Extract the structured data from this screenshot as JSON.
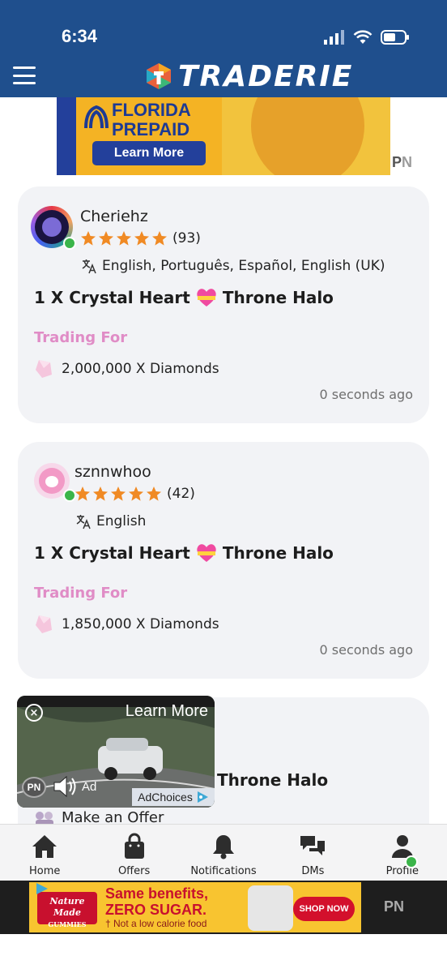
{
  "status_bar": {
    "time": "6:34"
  },
  "header": {
    "brand": "TRADERIE",
    "menu_icon": "hamburger-icon"
  },
  "ad_top": {
    "brand_line1": "FLORIDA",
    "brand_line2": "PREPAID",
    "cta": "Learn More",
    "badge_p": "P",
    "badge_n": "N"
  },
  "listings": [
    {
      "username": "Cheriehz",
      "stars": 5,
      "rating_count": "(93)",
      "languages": "English, Português, Español, English (UK)",
      "item": "1 X Crystal Heart",
      "item_suffix": "Throne Halo",
      "trading_for_label": "Trading For",
      "price": "2,000,000 X Diamonds",
      "posted": "0 seconds ago",
      "online": true
    },
    {
      "username": "sznnwhoo",
      "stars": 5,
      "rating_count": "(42)",
      "languages": "English",
      "item": "1 X Crystal Heart",
      "item_suffix": "Throne Halo",
      "trading_for_label": "Trading For",
      "price": "1,850,000 X Diamonds",
      "posted": "0 seconds ago",
      "online": true
    },
    {
      "item_suffix": "Throne Halo",
      "make_offer": "Make an Offer"
    }
  ],
  "video_ad": {
    "cta": "Learn More",
    "ad_label": "Ad",
    "choices": "AdChoices",
    "pn": "PN"
  },
  "bottom_nav": [
    {
      "label": "Home",
      "icon": "home-icon"
    },
    {
      "label": "Offers",
      "icon": "bag-icon"
    },
    {
      "label": "Notifications",
      "icon": "bell-icon"
    },
    {
      "label": "DMs",
      "icon": "chat-icon"
    },
    {
      "label": "Profile",
      "icon": "user-icon"
    }
  ],
  "ad_bottom": {
    "brand": "Nature Made",
    "brand_sub": "GUMMIES",
    "headline1": "Same benefits,",
    "headline2": "ZERO SUGAR.",
    "sub": "† Not a low calorie food",
    "cta": "SHOP NOW",
    "badge": "PN"
  },
  "colors": {
    "header": "#1f4f8d",
    "accent_pink": "#e08cc6",
    "star": "#f08a24",
    "online": "#3bb54a"
  }
}
